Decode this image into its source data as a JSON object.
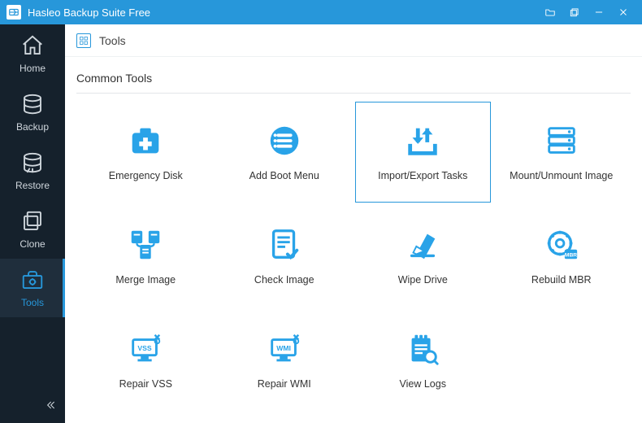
{
  "app": {
    "title": "Hasleo Backup Suite Free"
  },
  "sidebar": {
    "items": [
      {
        "label": "Home"
      },
      {
        "label": "Backup"
      },
      {
        "label": "Restore"
      },
      {
        "label": "Clone"
      },
      {
        "label": "Tools"
      }
    ]
  },
  "header": {
    "title": "Tools"
  },
  "section": {
    "title": "Common Tools"
  },
  "tools": [
    {
      "label": "Emergency Disk"
    },
    {
      "label": "Add Boot Menu"
    },
    {
      "label": "Import/Export Tasks"
    },
    {
      "label": "Mount/Unmount Image"
    },
    {
      "label": "Merge Image"
    },
    {
      "label": "Check Image"
    },
    {
      "label": "Wipe Drive"
    },
    {
      "label": "Rebuild MBR"
    },
    {
      "label": "Repair VSS"
    },
    {
      "label": "Repair WMI"
    },
    {
      "label": "View Logs"
    }
  ],
  "colors": {
    "accent": "#2797da",
    "sidebar": "#15212c"
  }
}
